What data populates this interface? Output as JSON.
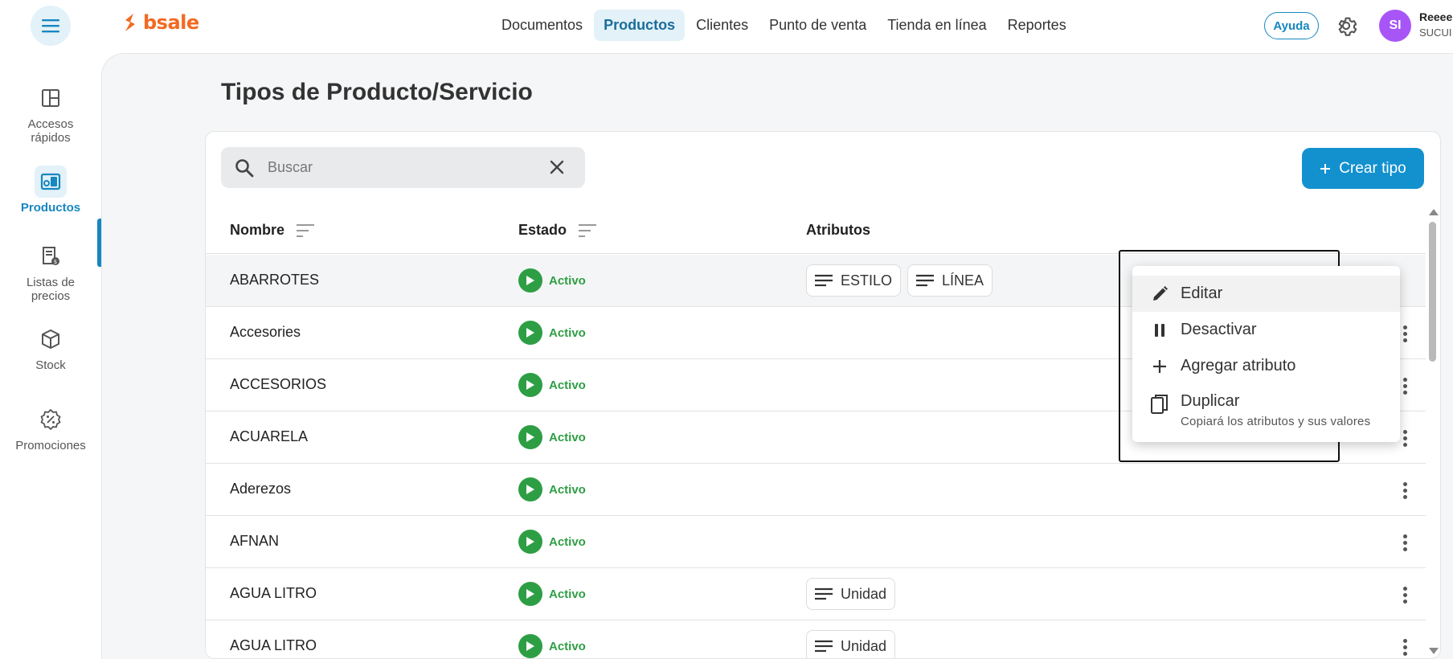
{
  "app": {
    "logo_text": "bsale",
    "brand_color": "#f26a21",
    "accent_color": "#1391cf"
  },
  "header": {
    "nav": [
      {
        "label": "Documentos",
        "active": false
      },
      {
        "label": "Productos",
        "active": true
      },
      {
        "label": "Clientes",
        "active": false
      },
      {
        "label": "Punto de venta",
        "active": false
      },
      {
        "label": "Tienda en línea",
        "active": false
      },
      {
        "label": "Reportes",
        "active": false
      }
    ],
    "help_label": "Ayuda",
    "avatar_initials": "SI",
    "user_name": "Reeee",
    "user_sub": "SUCUI"
  },
  "sidebar": {
    "items": [
      {
        "label": "Accesos rápidos",
        "icon": "layout-icon",
        "active": false
      },
      {
        "label": "Productos",
        "icon": "products-icon",
        "active": true
      },
      {
        "label": "Listas de precios",
        "icon": "price-list-icon",
        "active": false
      },
      {
        "label": "Stock",
        "icon": "box-icon",
        "active": false
      },
      {
        "label": "Promociones",
        "icon": "promo-badge-icon",
        "active": false
      }
    ]
  },
  "page": {
    "title": "Tipos de Producto/Servicio",
    "search_placeholder": "Buscar",
    "create_label": "Crear tipo",
    "columns": [
      "Nombre",
      "Estado",
      "Atributos"
    ],
    "rows": [
      {
        "name": "ABARROTES",
        "status": "Activo",
        "attributes": [
          "ESTILO",
          "LÍNEA"
        ]
      },
      {
        "name": "Accesories",
        "status": "Activo",
        "attributes": []
      },
      {
        "name": "ACCESORIOS",
        "status": "Activo",
        "attributes": []
      },
      {
        "name": "ACUARELA",
        "status": "Activo",
        "attributes": []
      },
      {
        "name": "Aderezos",
        "status": "Activo",
        "attributes": []
      },
      {
        "name": "AFNAN",
        "status": "Activo",
        "attributes": []
      },
      {
        "name": "AGUA LITRO",
        "status": "Activo",
        "attributes": [
          "Unidad"
        ]
      },
      {
        "name": "AGUA LITRO",
        "status": "Activo",
        "attributes": [
          "Unidad"
        ]
      }
    ],
    "status_color": "#2e9e44"
  },
  "context_menu": {
    "items": [
      {
        "label": "Editar",
        "icon": "pencil-icon",
        "sub": ""
      },
      {
        "label": "Desactivar",
        "icon": "pause-icon",
        "sub": ""
      },
      {
        "label": "Agregar atributo",
        "icon": "plus-icon",
        "sub": ""
      },
      {
        "label": "Duplicar",
        "icon": "copy-icon",
        "sub": "Copiará los atributos y sus valores"
      }
    ]
  }
}
